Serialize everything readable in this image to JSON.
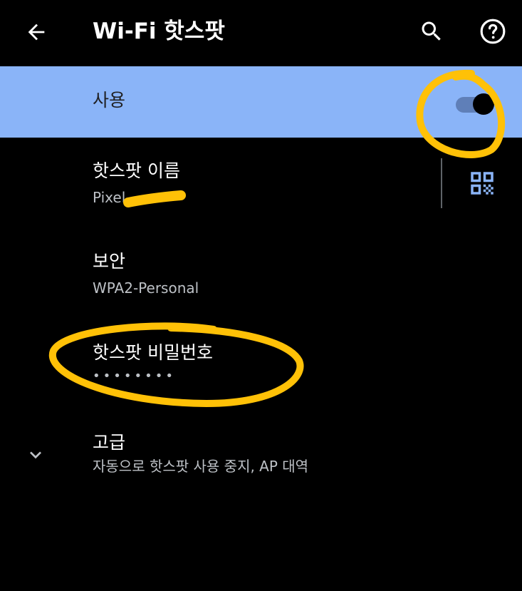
{
  "appbar": {
    "title": "Wi-Fi 핫스팟",
    "back_icon": "arrow-back-icon",
    "search_icon": "search-icon",
    "help_icon": "help-icon"
  },
  "master_switch": {
    "label": "사용",
    "state": "on"
  },
  "preferences": [
    {
      "title": "핫스팟 이름",
      "summary": "Pixel"
    },
    {
      "title": "보안",
      "summary": "WPA2-Personal"
    },
    {
      "title": "핫스팟 비밀번호",
      "summary": "••••••••"
    },
    {
      "title": "고급",
      "summary": "자동으로 핫스팟 사용 중지, AP 대역"
    }
  ],
  "qr_icon": "qr-code-icon",
  "expand_icon": "chevron-down-icon",
  "colors": {
    "background": "#000000",
    "accent": "#8AB4F8",
    "annotation": "#FFC107",
    "summary_text": "#bdc1c6"
  }
}
